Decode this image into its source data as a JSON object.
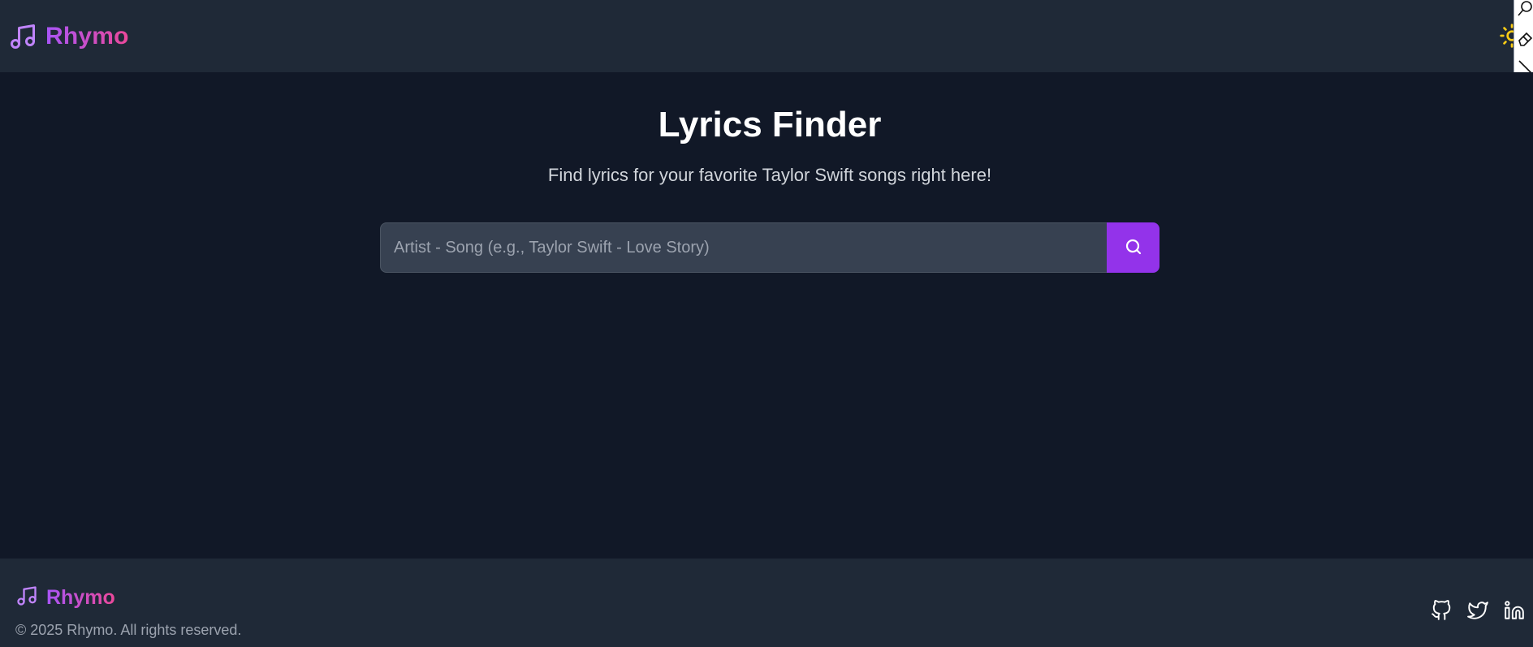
{
  "header": {
    "brand": "Rhymo",
    "brand_gradient": [
      "#a855f7",
      "#ec4899"
    ],
    "logo_icon": "music-note-icon",
    "theme_toggle_icon": "sun-icon"
  },
  "main": {
    "title": "Lyrics Finder",
    "subtitle": "Find lyrics for your favorite Taylor Swift songs right here!",
    "search": {
      "placeholder": "Artist - Song (e.g., Taylor Swift - Love Story)",
      "value": "",
      "button_icon": "search-icon"
    }
  },
  "footer": {
    "brand": "Rhymo",
    "copyright": "© 2025 Rhymo. All rights reserved.",
    "social_icons": [
      "github-icon",
      "twitter-icon",
      "linkedin-icon"
    ]
  },
  "colors": {
    "page_bg": "#111827",
    "bar_bg": "#1f2937",
    "accent": "#9333ea",
    "input_bg": "#374151",
    "sun": "#facc15"
  },
  "toolstrip": {
    "icons": [
      "zoom-icon",
      "eraser-icon",
      "pen-icon",
      "highlighter-icon",
      "dot-icon",
      "undo-icon",
      "trash-icon",
      "easel-icon",
      "camera-icon",
      "clipboard-icon"
    ],
    "swatches": [
      "#00aeef",
      "#ec008c",
      "#fff200"
    ]
  }
}
